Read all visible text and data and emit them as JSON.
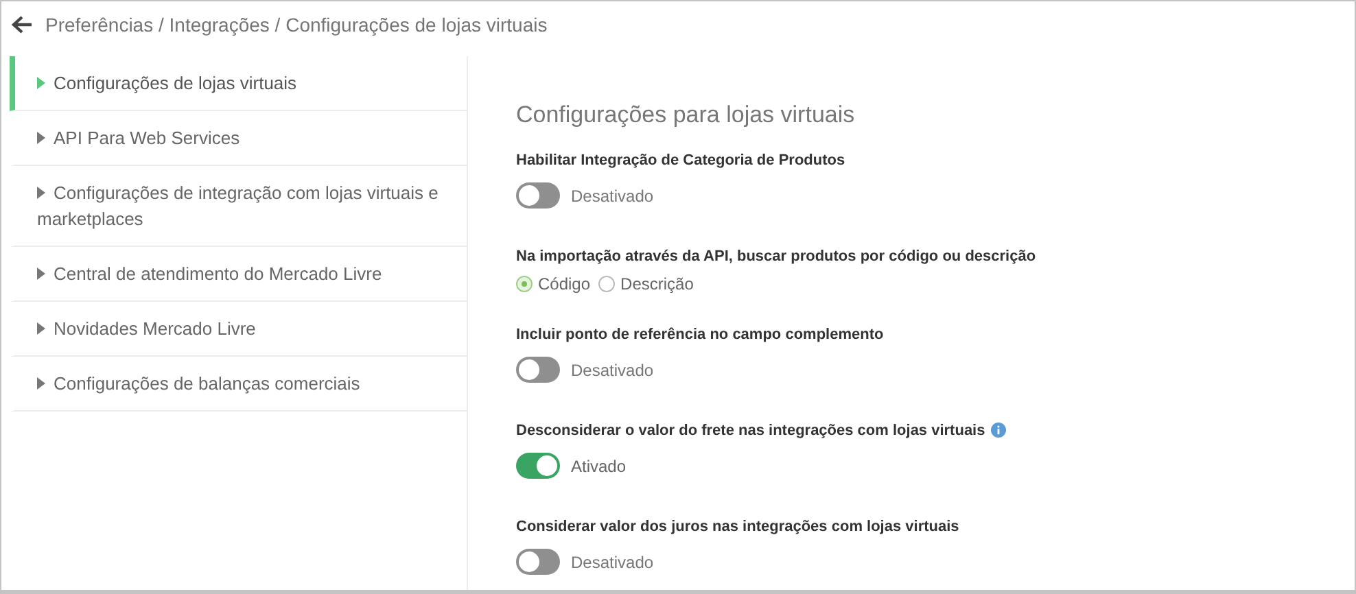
{
  "breadcrumb": "Preferências / Integrações / Configurações de lojas virtuais",
  "sidebar": {
    "items": [
      {
        "label": "Configurações de lojas virtuais",
        "selected": true
      },
      {
        "label": "API Para Web Services",
        "selected": false
      },
      {
        "label": "Configurações de integração com lojas virtuais e marketplaces",
        "selected": false
      },
      {
        "label": "Central de atendimento do Mercado Livre",
        "selected": false
      },
      {
        "label": "Novidades Mercado Livre",
        "selected": false
      },
      {
        "label": "Configurações de balanças comerciais",
        "selected": false
      }
    ]
  },
  "content": {
    "title": "Configurações para lojas virtuais",
    "settings": [
      {
        "kind": "toggle",
        "label": "Habilitar Integração de Categoria de Produtos",
        "on": false,
        "state_text": "Desativado"
      },
      {
        "kind": "radio",
        "label": "Na importação através da API, buscar produtos por código ou descrição",
        "options": [
          {
            "label": "Código",
            "selected": true
          },
          {
            "label": "Descrição",
            "selected": false
          }
        ]
      },
      {
        "kind": "toggle",
        "label": "Incluir ponto de referência no campo complemento",
        "on": false,
        "state_text": "Desativado"
      },
      {
        "kind": "toggle",
        "label": "Desconsiderar o valor do frete nas integrações com lojas virtuais",
        "on": true,
        "state_text": "Ativado",
        "info": true
      },
      {
        "kind": "toggle",
        "label": "Considerar valor dos juros nas integrações com lojas virtuais",
        "on": false,
        "state_text": "Desativado"
      }
    ]
  }
}
